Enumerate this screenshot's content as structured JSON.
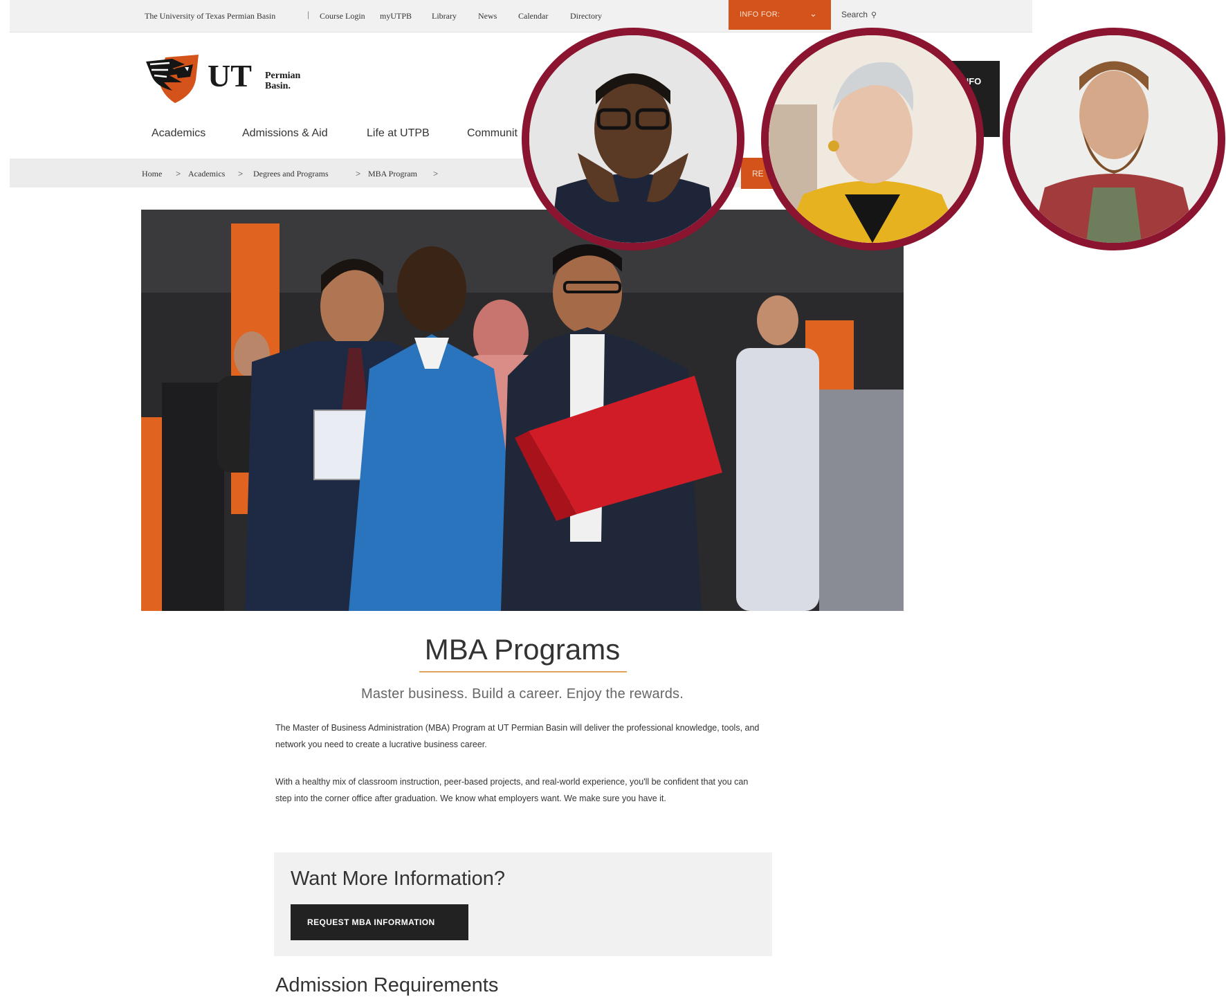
{
  "utility_bar": {
    "links": [
      "The University of Texas Permian Basin",
      "Course Login",
      "myUTPB",
      "Library",
      "News",
      "Calendar",
      "Directory"
    ],
    "info_for_label": "INFO FOR:",
    "search_label": "Search"
  },
  "logo": {
    "ut": "UT",
    "line1": "Permian",
    "line2": "Basin."
  },
  "request_info_partial": "ST INFO",
  "main_nav": [
    "Academics",
    "Admissions & Aid",
    "Life at UTPB",
    "Communit"
  ],
  "breadcrumbs": [
    "Home",
    "Academics",
    "Degrees and Programs",
    "MBA Program"
  ],
  "orange_button_partial": "RE",
  "page": {
    "title": "MBA Programs",
    "subtitle": "Master business. Build a career. Enjoy the rewards.",
    "paragraphs": [
      "The Master of Business Administration (MBA) Program at UT Permian Basin will deliver the professional knowledge, tools, and network you need to create a lucrative business career.",
      "With a healthy mix of classroom instruction, peer-based projects, and real-world experience, you'll be confident that you can step into the corner office after graduation. We know what employers want. We make sure you have it."
    ],
    "info_box": {
      "heading": "Want More Information?",
      "button": "REQUEST MBA INFORMATION"
    },
    "next_heading": "Admission Requirements"
  },
  "colors": {
    "accent_orange": "#d3531a",
    "avatar_ring": "#8b1430",
    "title_rule": "#e2a25a"
  },
  "icons": [
    "chevron-down-icon",
    "search-icon",
    "hawk-shield-icon"
  ]
}
